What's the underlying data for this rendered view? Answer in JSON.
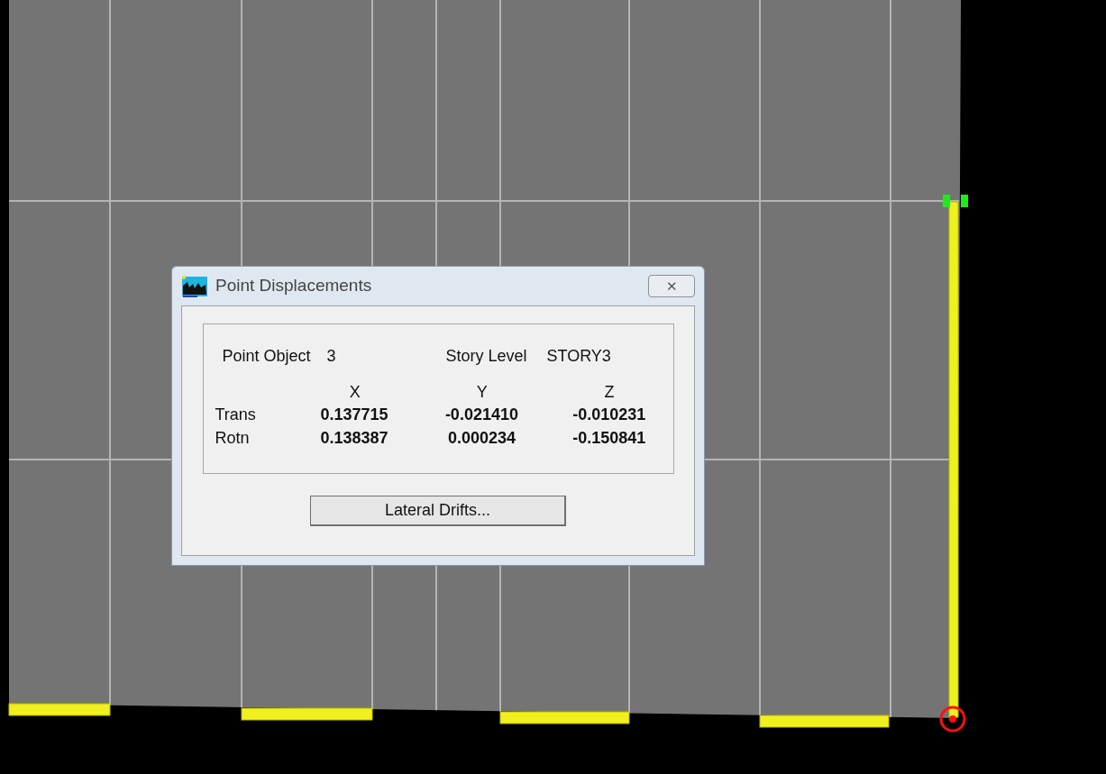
{
  "dialog": {
    "title": "Point Displacements",
    "close": "✕",
    "point_object": {
      "label": "Point Object",
      "value": "3"
    },
    "story_level": {
      "label": "Story Level",
      "value": "STORY3"
    },
    "columns": [
      "X",
      "Y",
      "Z"
    ],
    "rows": [
      {
        "label": "Trans",
        "values": [
          "0.137715",
          "-0.021410",
          "-0.010231"
        ]
      },
      {
        "label": "Rotn",
        "values": [
          "0.138387",
          "0.000234",
          "-0.150841"
        ]
      }
    ],
    "button": "Lateral Drifts..."
  }
}
